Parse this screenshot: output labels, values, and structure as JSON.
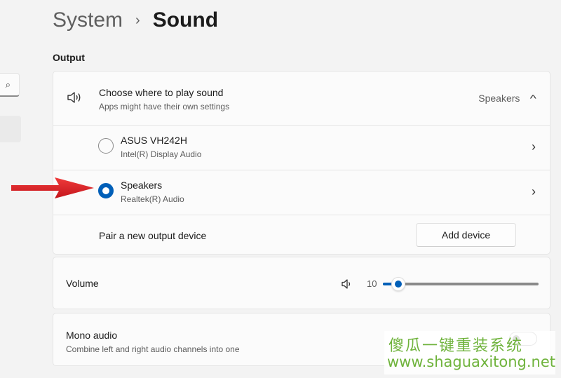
{
  "breadcrumb": {
    "parent": "System",
    "separator": "›",
    "current": "Sound"
  },
  "sidebar": {
    "search_icon": "search-icon"
  },
  "output": {
    "section_label": "Output",
    "choose": {
      "title": "Choose where to play sound",
      "subtitle": "Apps might have their own settings",
      "selected_value": "Speakers",
      "icon": "speaker-icon",
      "expanded": true
    },
    "devices": [
      {
        "name": "ASUS VH242H",
        "driver": "Intel(R) Display Audio",
        "selected": false
      },
      {
        "name": "Speakers",
        "driver": "Realtek(R) Audio",
        "selected": true
      }
    ],
    "pair": {
      "label": "Pair a new output device",
      "button": "Add device"
    }
  },
  "volume": {
    "label": "Volume",
    "value": "10",
    "percent": 10,
    "icon": "speaker-icon"
  },
  "mono": {
    "title": "Mono audio",
    "subtitle": "Combine left and right audio channels into one",
    "enabled": false
  },
  "annotation": {
    "arrow_color": "#d71920"
  },
  "watermark": {
    "chinese": "傻瓜一键重装系统",
    "url": "www.shaguaxitong.net"
  },
  "colors": {
    "accent": "#005fb8",
    "background": "#f3f3f3",
    "card": "#fbfbfb"
  }
}
